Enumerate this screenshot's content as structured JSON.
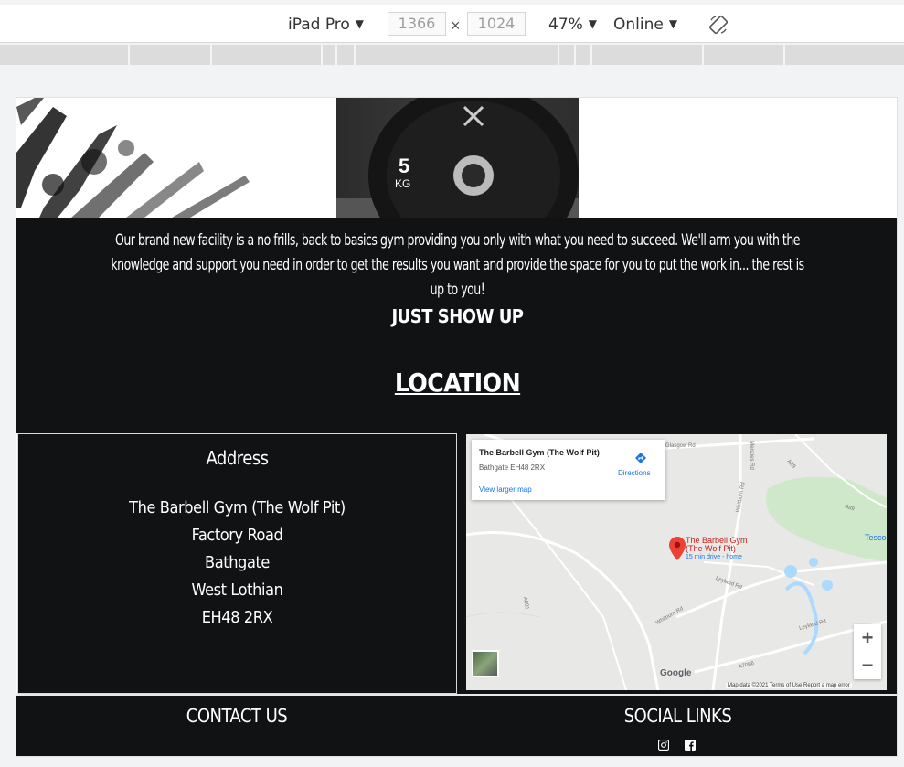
{
  "devtools": {
    "device": "iPad Pro",
    "width": "1366",
    "height": "1024",
    "times": "×",
    "zoom": "47%",
    "network": "Online",
    "caret": "▼"
  },
  "hero": {
    "plate_weight": "5",
    "plate_unit": "KG"
  },
  "intro": {
    "text": "Our brand new facility is a no frills, back to basics gym providing you only with what you need to succeed. We'll arm you with the knowledge and support you need in order to get the results you want and provide the space for you to put the work in... the rest is up to you!",
    "tagline": "JUST SHOW UP"
  },
  "location": {
    "heading": "LOCATION",
    "address_heading": "Address",
    "address_lines": [
      "The Barbell Gym (The Wolf Pit)",
      "Factory Road",
      "Bathgate",
      "West Lothian",
      "EH48 2RX"
    ]
  },
  "map": {
    "place_name": "The Barbell Gym (The Wolf Pit)",
    "place_address": "Bathgate EH48 2RX",
    "larger_map": "View larger map",
    "directions": "Directions",
    "pin_label_1": "The Barbell Gym",
    "pin_label_2": "(The Wolf Pit)",
    "pin_sub": "15 min drive - home",
    "tesco": "Tesco",
    "roads": [
      "Glasgow Rd",
      "Menzies Rd",
      "Whitburn Rd",
      "Leyland Rd",
      "Leyland Rd",
      "A801",
      "Whitburn Rd",
      "A7066",
      "A89",
      "A89"
    ],
    "zoom_in": "+",
    "zoom_out": "−",
    "google": "Google",
    "attribution": "Map data ©2021    Terms of Use    Report a map error"
  },
  "footer": {
    "contact": "CONTACT US",
    "social": "SOCIAL LINKS"
  },
  "colors": {
    "dark": "#111214",
    "link": "#1a73e8",
    "pin": "#ea4335"
  }
}
